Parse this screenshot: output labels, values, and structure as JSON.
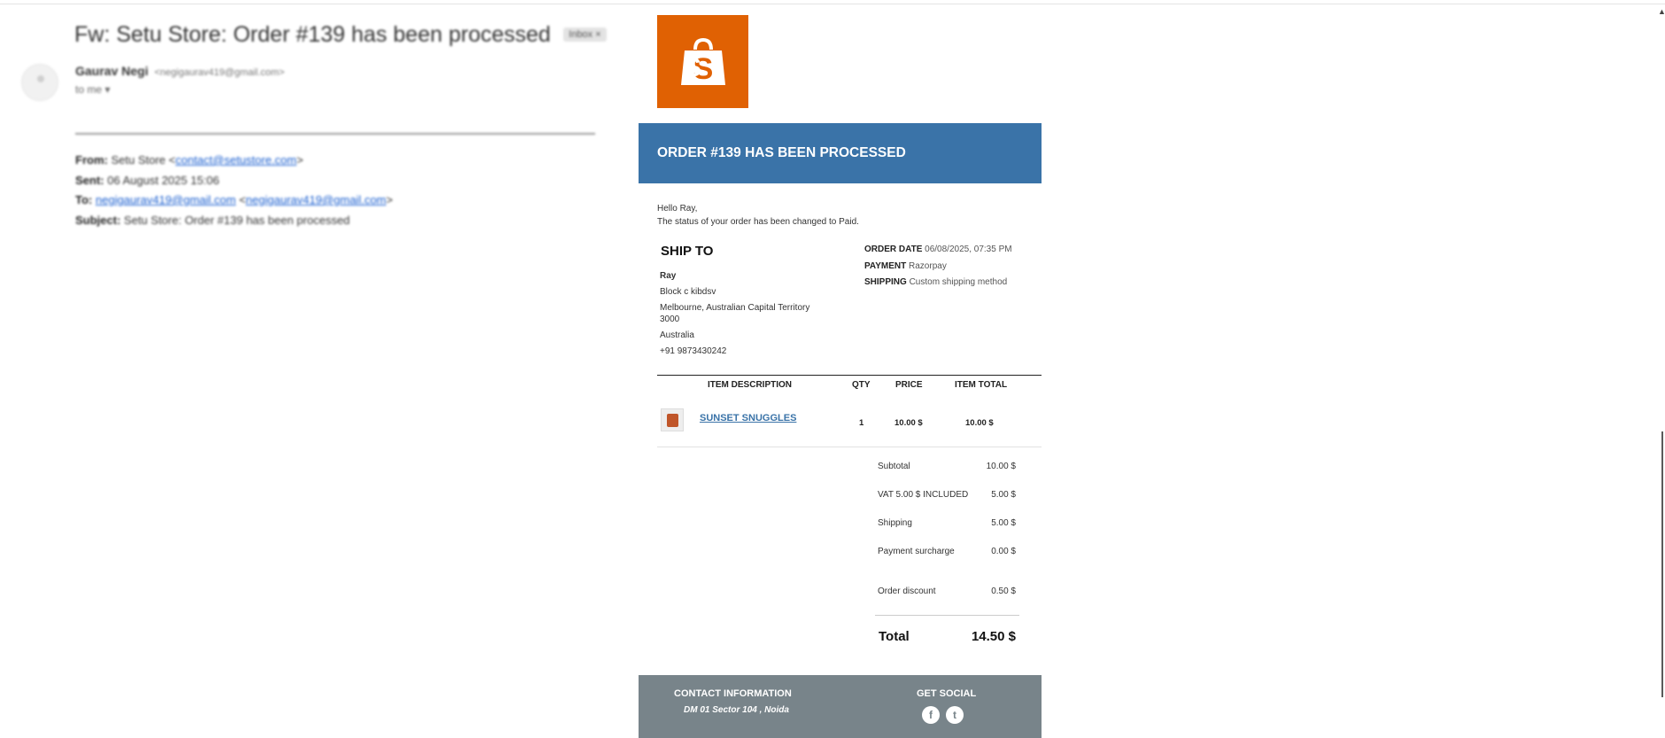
{
  "email_header": {
    "subject": "Fw: Setu Store: Order #139 has been processed",
    "folder_badge": "Inbox ×",
    "sender_name": "Gaurav Negi",
    "sender_email": "<negigaurav419@gmail.com>",
    "to_me": "to me ▾"
  },
  "forward": {
    "from_label": "From:",
    "from_text": "Setu Store <",
    "from_email": "contact@setustore.com",
    "from_close": ">",
    "sent_label": "Sent:",
    "sent_value": "06 August 2025 15:06",
    "to_label": "To:",
    "to_email": "negigaurav419@gmail.com",
    "to_open": " <",
    "to_email2": "negigaurav419@gmail.com",
    "to_close": ">",
    "subject_label": "Subject:",
    "subject_value": "Setu Store: Order #139 has been processed"
  },
  "order": {
    "banner": "ORDER #139 HAS BEEN PROCESSED",
    "greeting": "Hello Ray,",
    "status_line": "The status of your order has been changed to Paid.",
    "ship_to_heading": "SHIP TO",
    "ship_name": "Ray",
    "ship_line1": "Block c kibdsv",
    "ship_line2": "Melbourne, Australian Capital Territory 3000",
    "ship_country": "Australia",
    "ship_phone": "+91 9873430242",
    "order_date_label": "ORDER DATE",
    "order_date_value": "06/08/2025, 07:35 PM",
    "payment_label": "PAYMENT",
    "payment_value": "Razorpay",
    "shipping_label": "SHIPPING",
    "shipping_value": "Custom shipping method"
  },
  "items_table": {
    "headers": [
      "ITEM DESCRIPTION",
      "QTY",
      "PRICE",
      "ITEM TOTAL"
    ],
    "rows": [
      {
        "name": "SUNSET SNUGGLES",
        "qty": "1",
        "price": "10.00 $",
        "total": "10.00 $"
      }
    ]
  },
  "totals": {
    "subtotal_label": "Subtotal",
    "subtotal_value": "10.00 $",
    "vat_label": "VAT 5.00 $ INCLUDED",
    "vat_value": "5.00 $",
    "shipping_label": "Shipping",
    "shipping_value": "5.00 $",
    "surcharge_label": "Payment surcharge",
    "surcharge_value": "0.00 $",
    "discount_label": "Order discount",
    "discount_value": "0.50 $",
    "total_label": "Total",
    "total_value": "14.50 $"
  },
  "footer": {
    "contact_heading": "CONTACT INFORMATION",
    "contact_address": "DM 01 Sector 104 , Noida",
    "social_heading": "GET SOCIAL",
    "facebook_glyph": "f",
    "twitter_glyph": "t"
  },
  "colors": {
    "brand_orange": "#e06103",
    "banner_blue": "#3a73a8",
    "footer_gray": "#78848a"
  }
}
